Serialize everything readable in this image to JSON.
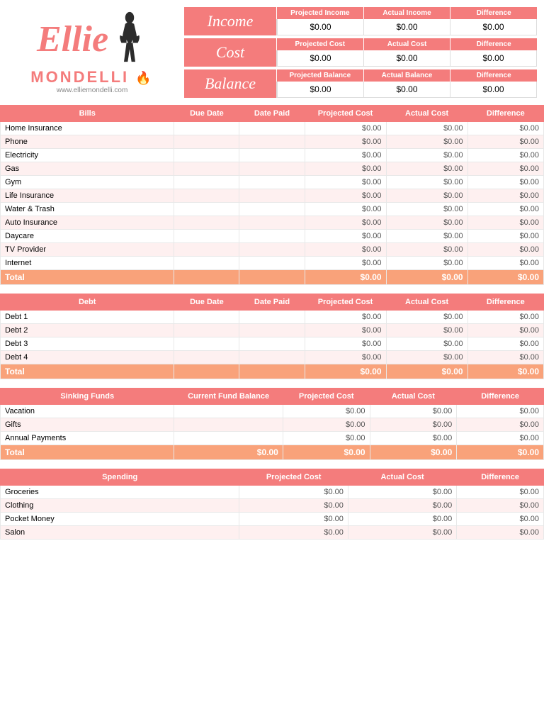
{
  "header": {
    "logo_ellie": "Ellie",
    "logo_mondelli": "MONDELLI",
    "logo_website": "www.elliemondelli.com",
    "income": {
      "label": "Income",
      "headers": [
        "Projected Income",
        "Actual Income",
        "Difference"
      ],
      "values": [
        "$0.00",
        "$0.00",
        "$0.00"
      ]
    },
    "cost": {
      "label": "Cost",
      "headers": [
        "Projected Cost",
        "Actual Cost",
        "Difference"
      ],
      "values": [
        "$0.00",
        "$0.00",
        "$0.00"
      ]
    },
    "balance": {
      "label": "Balance",
      "headers": [
        "Projected Balance",
        "Actual Balance",
        "Difference"
      ],
      "values": [
        "$0.00",
        "$0.00",
        "$0.00"
      ]
    }
  },
  "bills": {
    "section_label": "Bills",
    "headers": [
      "Bills",
      "Due Date",
      "Date Paid",
      "Projected Cost",
      "Actual Cost",
      "Difference"
    ],
    "rows": [
      {
        "name": "Home Insurance",
        "due": "",
        "paid": "",
        "proj": "$0.00",
        "actual": "$0.00",
        "diff": "$0.00"
      },
      {
        "name": "Phone",
        "due": "",
        "paid": "",
        "proj": "$0.00",
        "actual": "$0.00",
        "diff": "$0.00"
      },
      {
        "name": "Electricity",
        "due": "",
        "paid": "",
        "proj": "$0.00",
        "actual": "$0.00",
        "diff": "$0.00"
      },
      {
        "name": "Gas",
        "due": "",
        "paid": "",
        "proj": "$0.00",
        "actual": "$0.00",
        "diff": "$0.00"
      },
      {
        "name": "Gym",
        "due": "",
        "paid": "",
        "proj": "$0.00",
        "actual": "$0.00",
        "diff": "$0.00"
      },
      {
        "name": "Life Insurance",
        "due": "",
        "paid": "",
        "proj": "$0.00",
        "actual": "$0.00",
        "diff": "$0.00"
      },
      {
        "name": "Water & Trash",
        "due": "",
        "paid": "",
        "proj": "$0.00",
        "actual": "$0.00",
        "diff": "$0.00"
      },
      {
        "name": "Auto Insurance",
        "due": "",
        "paid": "",
        "proj": "$0.00",
        "actual": "$0.00",
        "diff": "$0.00"
      },
      {
        "name": "Daycare",
        "due": "",
        "paid": "",
        "proj": "$0.00",
        "actual": "$0.00",
        "diff": "$0.00"
      },
      {
        "name": "TV Provider",
        "due": "",
        "paid": "",
        "proj": "$0.00",
        "actual": "$0.00",
        "diff": "$0.00"
      },
      {
        "name": "Internet",
        "due": "",
        "paid": "",
        "proj": "$0.00",
        "actual": "$0.00",
        "diff": "$0.00"
      }
    ],
    "total": {
      "label": "Total",
      "proj": "$0.00",
      "actual": "$0.00",
      "diff": "$0.00"
    }
  },
  "debt": {
    "section_label": "Debt",
    "headers": [
      "Debt",
      "Due Date",
      "Date Paid",
      "Projected Cost",
      "Actual Cost",
      "Difference"
    ],
    "rows": [
      {
        "name": "Debt 1",
        "due": "",
        "paid": "",
        "proj": "$0.00",
        "actual": "$0.00",
        "diff": "$0.00"
      },
      {
        "name": "Debt 2",
        "due": "",
        "paid": "",
        "proj": "$0.00",
        "actual": "$0.00",
        "diff": "$0.00"
      },
      {
        "name": "Debt 3",
        "due": "",
        "paid": "",
        "proj": "$0.00",
        "actual": "$0.00",
        "diff": "$0.00"
      },
      {
        "name": "Debt 4",
        "due": "",
        "paid": "",
        "proj": "$0.00",
        "actual": "$0.00",
        "diff": "$0.00"
      }
    ],
    "total": {
      "label": "Total",
      "proj": "$0.00",
      "actual": "$0.00",
      "diff": "$0.00"
    }
  },
  "sinking": {
    "section_label": "Sinking Funds",
    "headers": [
      "Sinking Funds",
      "Current Fund Balance",
      "Projected Cost",
      "Actual Cost",
      "Difference"
    ],
    "rows": [
      {
        "name": "Vacation",
        "balance": "",
        "proj": "$0.00",
        "actual": "$0.00",
        "diff": "$0.00"
      },
      {
        "name": "Gifts",
        "balance": "",
        "proj": "$0.00",
        "actual": "$0.00",
        "diff": "$0.00"
      },
      {
        "name": "Annual Payments",
        "balance": "",
        "proj": "$0.00",
        "actual": "$0.00",
        "diff": "$0.00"
      }
    ],
    "total": {
      "label": "Total",
      "balance": "$0.00",
      "proj": "$0.00",
      "actual": "$0.00",
      "diff": "$0.00"
    }
  },
  "spending": {
    "section_label": "Spending",
    "headers": [
      "Spending",
      "Projected Cost",
      "Actual Cost",
      "Difference"
    ],
    "rows": [
      {
        "name": "Groceries",
        "proj": "$0.00",
        "actual": "$0.00",
        "diff": "$0.00"
      },
      {
        "name": "Clothing",
        "proj": "$0.00",
        "actual": "$0.00",
        "diff": "$0.00"
      },
      {
        "name": "Pocket Money",
        "proj": "$0.00",
        "actual": "$0.00",
        "diff": "$0.00"
      },
      {
        "name": "Salon",
        "proj": "$0.00",
        "actual": "$0.00",
        "diff": "$0.00"
      }
    ]
  }
}
